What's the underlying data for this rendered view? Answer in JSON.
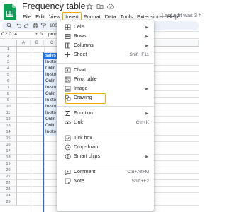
{
  "app": {
    "document_title": "Frequency table",
    "title_icons": [
      "star-icon",
      "move-to-folder-icon",
      "cloud-saved-icon"
    ]
  },
  "menubar": {
    "items": [
      "File",
      "Edit",
      "View",
      "Insert",
      "Format",
      "Data",
      "Tools",
      "Extensions",
      "Help"
    ],
    "active": "Insert",
    "last_edit": "Last edit was 3 h"
  },
  "toolbar": {
    "zoom": "100"
  },
  "formula_bar": {
    "name_box": "C2:C14",
    "fx": "fx",
    "content": "prod"
  },
  "grid": {
    "columns": [
      "A",
      "B",
      "C"
    ],
    "rows": [
      "1",
      "2",
      "3",
      "4",
      "5",
      "6",
      "7",
      "8",
      "9",
      "10",
      "11",
      "12",
      "13",
      "14",
      "15",
      "16",
      "17",
      "18",
      "19",
      "20",
      "21",
      "22",
      "23",
      "24",
      "25"
    ],
    "cells_c": [
      "sales",
      "In-sto",
      "Onlin",
      "In-sto",
      "Onlin",
      "In-sto",
      "Onlin",
      "In-sto",
      "In-sto",
      "In-sto",
      "Onlin",
      "Onlin",
      "In-sto"
    ]
  },
  "insert_menu": {
    "items": [
      {
        "label": "Cells",
        "icon": "grid-icon",
        "submenu": true
      },
      {
        "label": "Rows",
        "icon": "rows-icon",
        "submenu": true
      },
      {
        "label": "Columns",
        "icon": "columns-icon",
        "submenu": true
      },
      {
        "label": "Sheet",
        "icon": "add-icon",
        "shortcut": "Shift+F11"
      },
      {
        "label": "Chart",
        "icon": "chart-icon"
      },
      {
        "label": "Pivot table",
        "icon": "pivot-table-icon",
        "highlighted": true
      },
      {
        "label": "Image",
        "icon": "image-icon",
        "submenu": true
      },
      {
        "label": "Drawing",
        "icon": "drawing-icon"
      },
      {
        "label": "Function",
        "icon": "function-icon",
        "submenu": true
      },
      {
        "label": "Link",
        "icon": "link-icon",
        "shortcut": "Ctrl+K"
      },
      {
        "label": "Tick box",
        "icon": "checkbox-icon"
      },
      {
        "label": "Drop-down",
        "icon": "dropdown-icon"
      },
      {
        "label": "Smart chips",
        "icon": "smart-chip-icon",
        "submenu": true
      },
      {
        "label": "Comment",
        "icon": "comment-icon",
        "shortcut": "Ctrl+Alt+M"
      },
      {
        "label": "Note",
        "icon": "note-icon",
        "shortcut": "Shift+F2"
      }
    ]
  },
  "colors": {
    "highlight_outline": "#f9ab00",
    "header_cell": "#1a73e8",
    "selection_fill": "#e8f0fe",
    "sheets_green": "#0f9d58"
  }
}
